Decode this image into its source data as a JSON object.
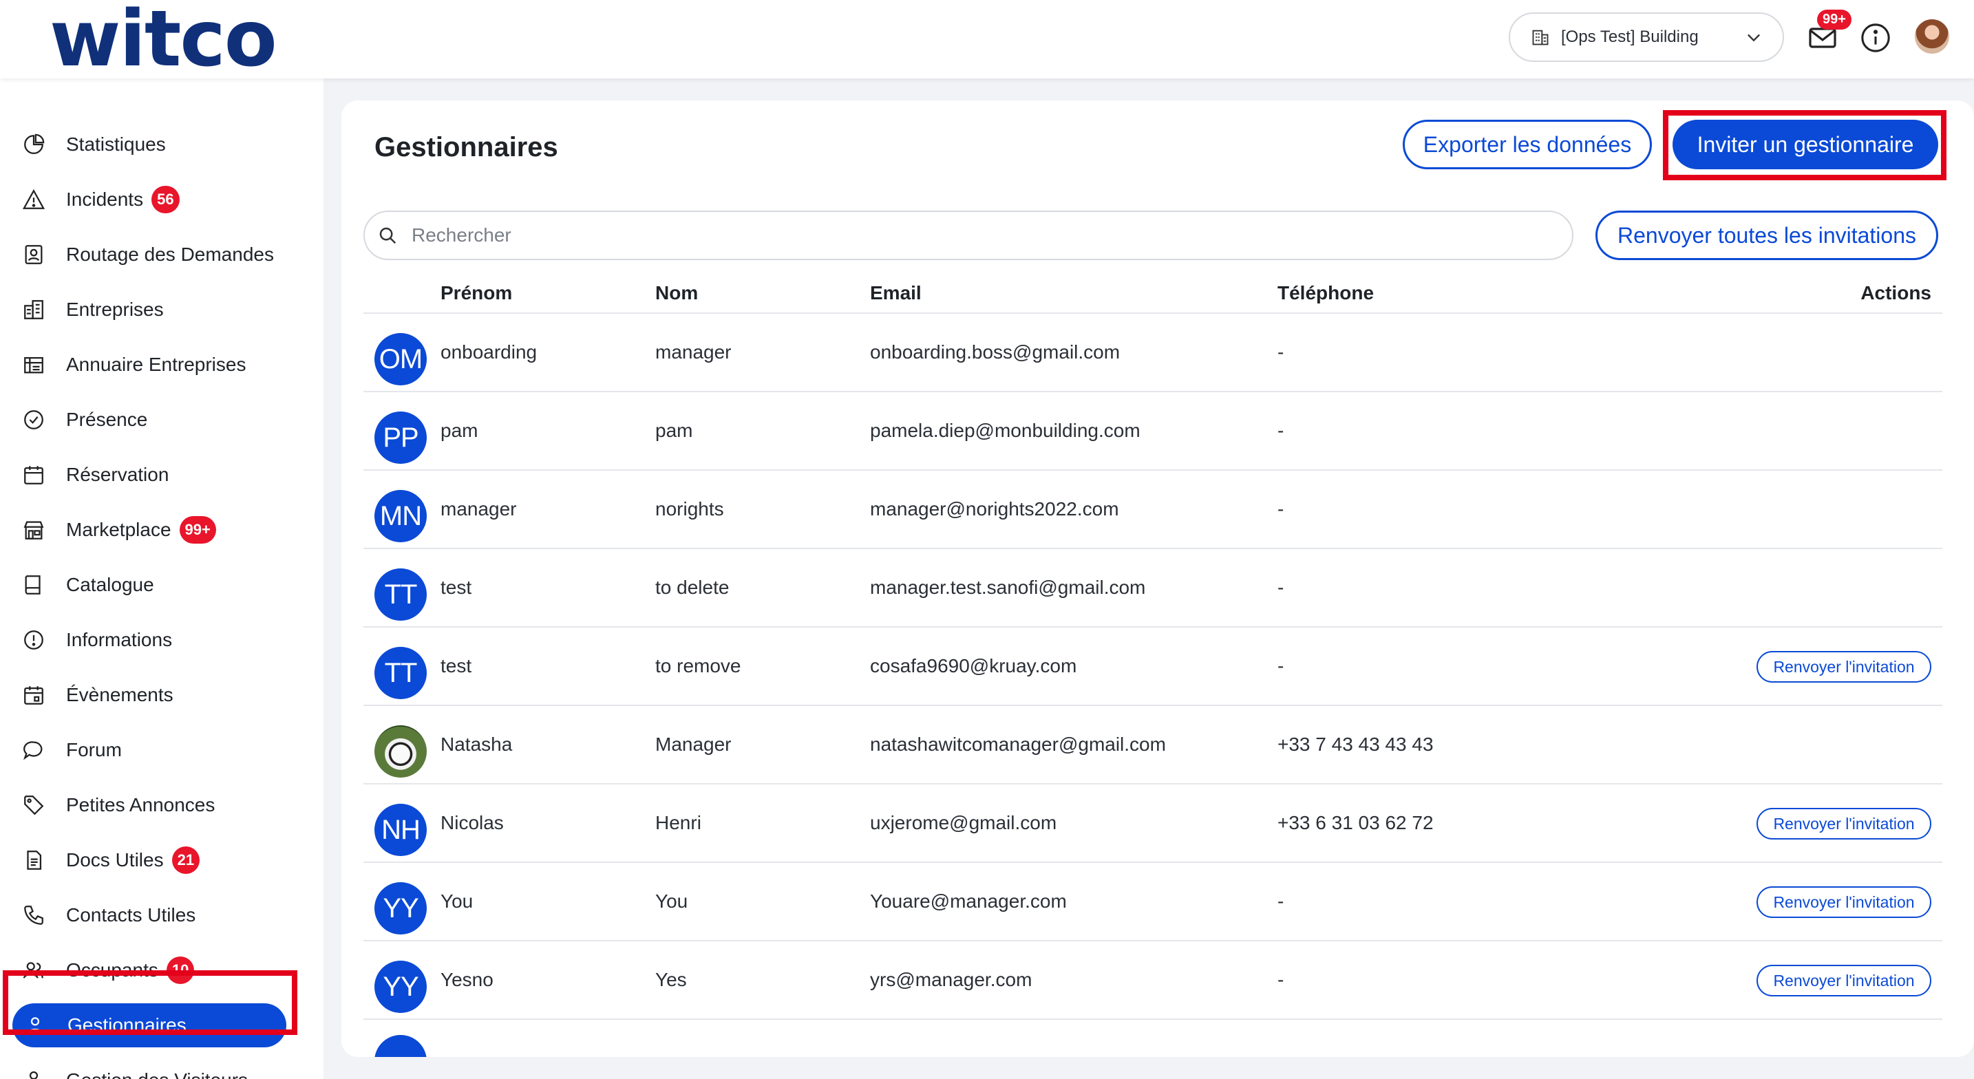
{
  "app": {
    "logo": "witco"
  },
  "header": {
    "building": "[Ops Test] Building",
    "mail_badge": "99+"
  },
  "sidebar": {
    "items": [
      {
        "label": "Statistiques",
        "icon": "pie-chart-icon",
        "badge": null
      },
      {
        "label": "Incidents",
        "icon": "warning-icon",
        "badge": "56"
      },
      {
        "label": "Routage des Demandes",
        "icon": "contact-card-icon",
        "badge": null
      },
      {
        "label": "Entreprises",
        "icon": "buildings-icon",
        "badge": null
      },
      {
        "label": "Annuaire Entreprises",
        "icon": "directory-icon",
        "badge": null
      },
      {
        "label": "Présence",
        "icon": "check-circle-icon",
        "badge": null
      },
      {
        "label": "Réservation",
        "icon": "calendar-icon",
        "badge": null
      },
      {
        "label": "Marketplace",
        "icon": "store-icon",
        "badge": "99+"
      },
      {
        "label": "Catalogue",
        "icon": "book-icon",
        "badge": null
      },
      {
        "label": "Informations",
        "icon": "info-icon",
        "badge": null
      },
      {
        "label": "Évènements",
        "icon": "event-calendar-icon",
        "badge": null
      },
      {
        "label": "Forum",
        "icon": "chat-bubble-icon",
        "badge": null
      },
      {
        "label": "Petites Annonces",
        "icon": "tag-icon",
        "badge": null
      },
      {
        "label": "Docs Utiles",
        "icon": "document-icon",
        "badge": "21"
      },
      {
        "label": "Contacts Utiles",
        "icon": "phone-icon",
        "badge": null
      },
      {
        "label": "Occupants",
        "icon": "users-icon",
        "badge": "10"
      },
      {
        "label": "Gestionnaires",
        "icon": "user-icon",
        "badge": null,
        "active": true
      },
      {
        "label": "Gestion des Visiteurs",
        "icon": "visitor-icon",
        "badge": null
      }
    ]
  },
  "main": {
    "title": "Gestionnaires",
    "export_label": "Exporter les données",
    "invite_label": "Inviter un gestionnaire",
    "search_placeholder": "Rechercher",
    "resend_all_label": "Renvoyer toutes les invitations",
    "columns": {
      "first_name": "Prénom",
      "last_name": "Nom",
      "email": "Email",
      "phone": "Téléphone",
      "actions": "Actions"
    },
    "resend_label": "Renvoyer l'invitation",
    "rows": [
      {
        "initials": "OM",
        "first_name": "onboarding",
        "last_name": "manager",
        "email": "onboarding.boss@gmail.com",
        "phone": "-",
        "resend": false
      },
      {
        "initials": "PP",
        "first_name": "pam",
        "last_name": "pam",
        "email": "pamela.diep@monbuilding.com",
        "phone": "-",
        "resend": false
      },
      {
        "initials": "MN",
        "first_name": "manager",
        "last_name": "norights",
        "email": "manager@norights2022.com",
        "phone": "-",
        "resend": false
      },
      {
        "initials": "TT",
        "first_name": "test",
        "last_name": "to delete",
        "email": "manager.test.sanofi@gmail.com",
        "phone": "-",
        "resend": false
      },
      {
        "initials": "TT",
        "first_name": "test",
        "last_name": "to remove",
        "email": "cosafa9690@kruay.com",
        "phone": "-",
        "resend": true
      },
      {
        "initials": "",
        "photo": true,
        "first_name": "Natasha",
        "last_name": "Manager",
        "email": "natashawitcomanager@gmail.com",
        "phone": "+33 7 43 43 43 43",
        "resend": false
      },
      {
        "initials": "NH",
        "first_name": "Nicolas",
        "last_name": "Henri",
        "email": "uxjerome@gmail.com",
        "phone": "+33 6 31 03 62 72",
        "resend": true
      },
      {
        "initials": "YY",
        "first_name": "You",
        "last_name": "You",
        "email": "Youare@manager.com",
        "phone": "-",
        "resend": true
      },
      {
        "initials": "YY",
        "first_name": "Yesno",
        "last_name": "Yes",
        "email": "yrs@manager.com",
        "phone": "-",
        "resend": true
      }
    ]
  },
  "colors": {
    "primary": "#0b4ad6",
    "brand": "#10307a",
    "badge": "#e8152b",
    "highlight": "#e3001b"
  }
}
